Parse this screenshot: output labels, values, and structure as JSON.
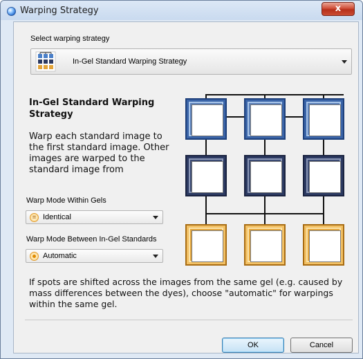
{
  "window": {
    "title": "Warping Strategy",
    "close_label": "x"
  },
  "strategy": {
    "section_label": "Select warping strategy",
    "selected": "In-Gel Standard Warping Strategy",
    "icon": "strategy-diagram-icon"
  },
  "description": {
    "title": "In-Gel Standard Warping Strategy",
    "text": "Warp each standard image to the first standard image. Other images are warped to the standard image from"
  },
  "mode_within": {
    "label": "Warp Mode Within Gels",
    "selected": "Identical",
    "icon": "equals-icon"
  },
  "mode_between": {
    "label": "Warp Mode Between In-Gel Standards",
    "selected": "Automatic",
    "icon": "dot-icon"
  },
  "hint": "If spots are shifted across the images from the same gel (e.g. caused by mass differences between the dyes), choose \"automatic\" for warpings within the same gel.",
  "buttons": {
    "ok": "OK",
    "cancel": "Cancel"
  },
  "colors": {
    "standard_frame": "#3a64a8",
    "image_frame": "#2c3a62",
    "warped_frame": "#e3a43a"
  }
}
